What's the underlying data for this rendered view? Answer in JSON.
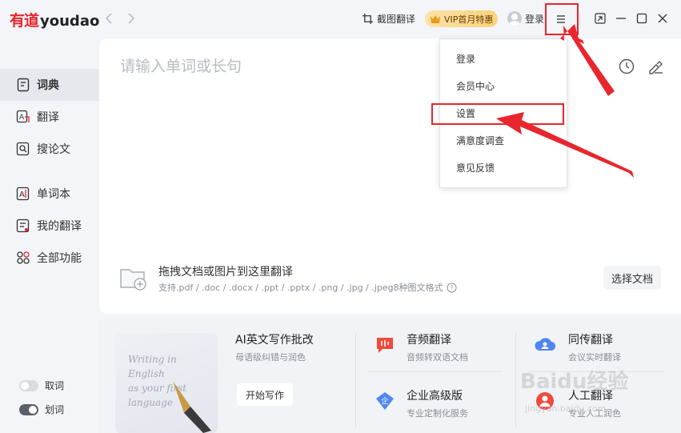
{
  "app": {
    "logo_cn": "有道",
    "logo_en": "youdao"
  },
  "toolbar": {
    "screenshot_translate": "截图翻译",
    "vip_label": "VIP首月特惠",
    "login_label": "登录"
  },
  "sidebar": {
    "items": [
      {
        "label": "词典",
        "icon": "dictionary-icon",
        "active": true
      },
      {
        "label": "翻译",
        "icon": "translate-icon",
        "active": false
      },
      {
        "label": "搜论文",
        "icon": "paper-search-icon",
        "active": false
      },
      {
        "label": "单词本",
        "icon": "wordbook-icon",
        "active": false
      },
      {
        "label": "我的翻译",
        "icon": "my-translation-icon",
        "active": false
      },
      {
        "label": "全部功能",
        "icon": "all-features-icon",
        "active": false
      }
    ],
    "toggles": [
      {
        "label": "取词",
        "on": false
      },
      {
        "label": "划词",
        "on": true
      }
    ]
  },
  "main": {
    "search_placeholder": "请输入单词或长句",
    "drop_title": "拖拽文档或图片到这里翻译",
    "drop_formats": "支持.pdf / .doc / .docx / .ppt / .pptx / .png / .jpg / .jpeg8种图文格式",
    "select_doc_label": "选择文档"
  },
  "features": {
    "promo_text": [
      "Writing in",
      "English",
      "as your first",
      "language"
    ],
    "ai_writing": {
      "title": "AI英文写作批改",
      "sub": "母语级纠错与润色",
      "button": "开始写作"
    },
    "audio_translate": {
      "title": "音频翻译",
      "sub": "音频转双语文档"
    },
    "simul_translate": {
      "title": "同传翻译",
      "sub": "会议实时翻译"
    },
    "enterprise": {
      "title": "企业高级版",
      "sub": "专业定制化服务"
    },
    "human_translate": {
      "title": "人工翻译",
      "sub": "专业人工润色"
    }
  },
  "dropdown": {
    "items": [
      "登录",
      "会员中心",
      "设置",
      "满意度调查",
      "意见反馈"
    ]
  },
  "watermark": {
    "text": "Baidu经验",
    "sub": "jingyan.baidu.com"
  },
  "colors": {
    "brand_red": "#e8252e",
    "annotation_red": "#e8262d",
    "vip_gold": "#f9d37c"
  }
}
